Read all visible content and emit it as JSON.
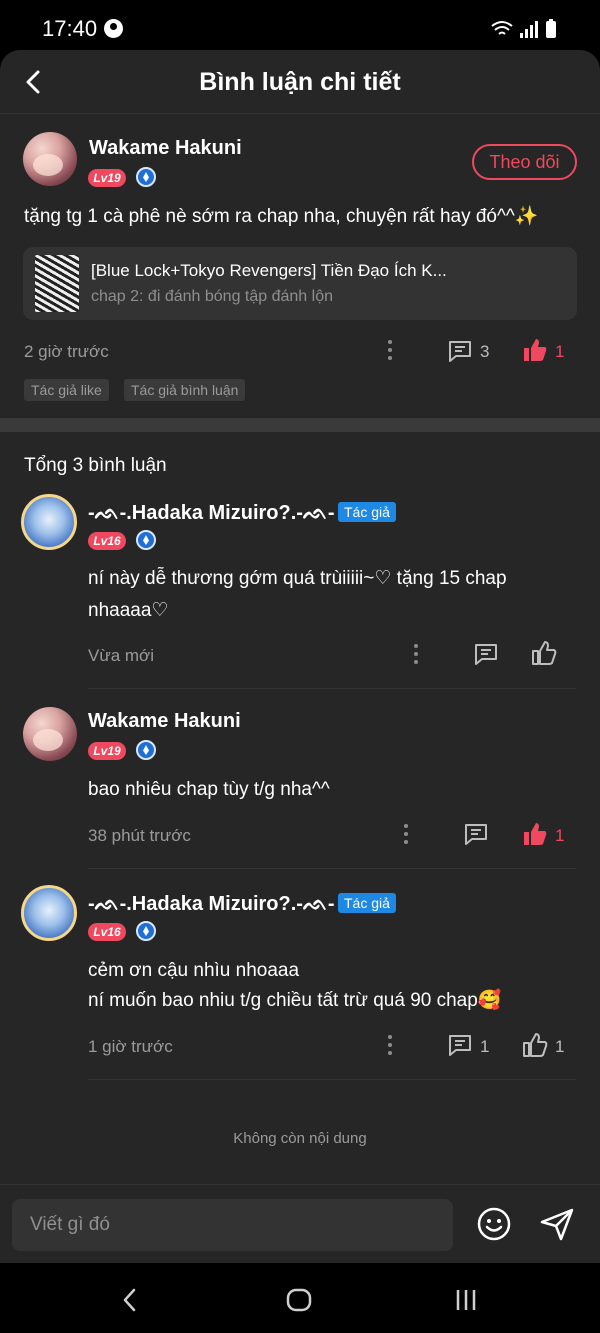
{
  "status": {
    "time": "17:40"
  },
  "header": {
    "title": "Bình luận chi tiết"
  },
  "post": {
    "author": "Wakame Hakuni",
    "level": "Lv19",
    "follow_label": "Theo dõi",
    "text": "tặng tg 1 cà phê nè sớm ra chap nha, chuyện rất hay đó^^✨",
    "chapter": {
      "title": "[Blue Lock+Tokyo Revengers] Tiền Đạo Ích K...",
      "subtitle": "chap 2: đi đánh bóng tập đánh lộn"
    },
    "time": "2 giờ trước",
    "comments": "3",
    "likes": "1",
    "chips": [
      "Tác giả like",
      "Tác giả bình luận"
    ]
  },
  "total_label": "Tổng 3 bình luận",
  "replies": [
    {
      "author": "-ᨒ-.Hadaka Mizuiro?.-ᨒ-",
      "level": "Lv16",
      "tag": "Tác giả",
      "text": [
        "ní này dễ thương gớm quá trùiiiii~♡ tặng 15 chap",
        "nhaaaa♡"
      ],
      "time": "Vừa mới",
      "comments": "",
      "likes": ""
    },
    {
      "author": "Wakame Hakuni",
      "level": "Lv19",
      "tag": "",
      "text": [
        "bao nhiêu chap tùy t/g nha^^"
      ],
      "time": "38 phút trước",
      "comments": "",
      "likes": "1"
    },
    {
      "author": "-ᨒ-.Hadaka Mizuiro?.-ᨒ-",
      "level": "Lv16",
      "tag": "Tác giả",
      "text": [
        "cẻm ơn cậu nhìu nhoaaa",
        "ní muốn bao nhiu t/g chiều tất trừ quá 90 chap🥰"
      ],
      "time": "1 giờ trước",
      "comments": "1",
      "likes": "1"
    }
  ],
  "end_text": "Không còn nội dung",
  "composer": {
    "placeholder": "Viết gì đó"
  },
  "colors": {
    "accent": "#f0485e",
    "sheet": "#262626",
    "author_tag": "#1e88e5"
  },
  "icons": [
    "back-icon",
    "account-icon",
    "wifi-icon",
    "signal-icon",
    "battery-icon",
    "verified-icon",
    "more-icon",
    "comment-icon",
    "like-icon",
    "emoji-icon",
    "send-icon",
    "nav-back-icon",
    "nav-home-icon",
    "nav-recents-icon"
  ]
}
